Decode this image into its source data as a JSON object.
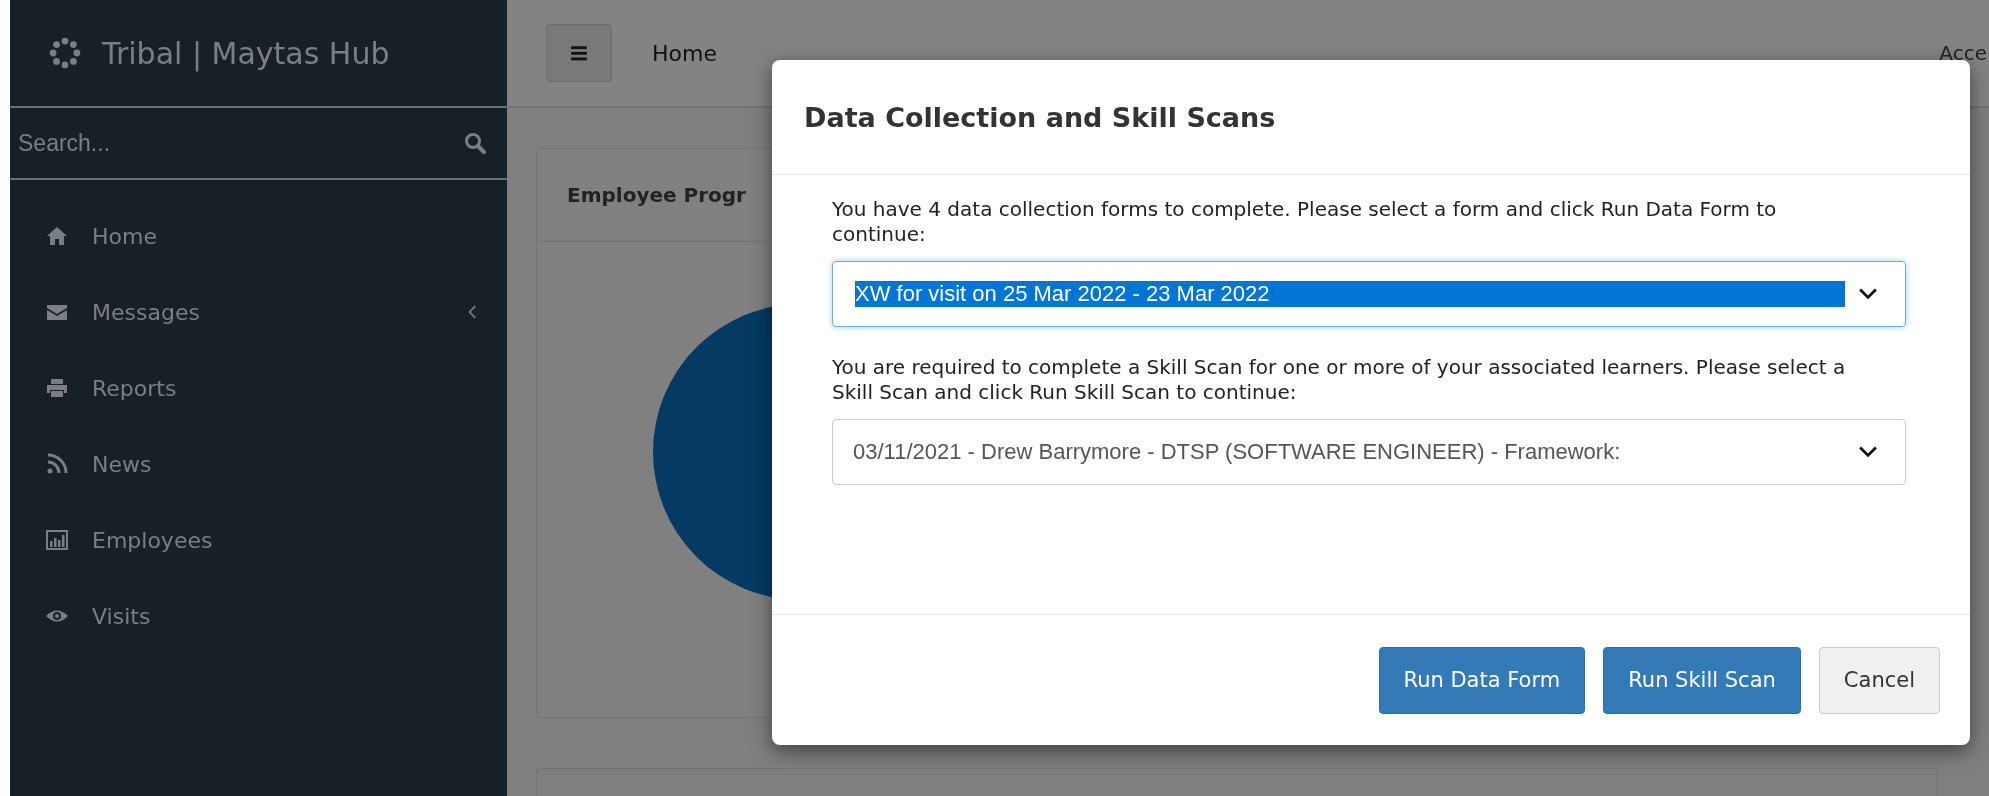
{
  "sidebar": {
    "brand": "Tribal | Maytas Hub",
    "search": {
      "placeholder": "Search..."
    },
    "items": [
      {
        "label": "Home",
        "has_submenu": false
      },
      {
        "label": "Messages",
        "has_submenu": true
      },
      {
        "label": "Reports",
        "has_submenu": false
      },
      {
        "label": "News",
        "has_submenu": false
      },
      {
        "label": "Employees",
        "has_submenu": false
      },
      {
        "label": "Visits",
        "has_submenu": false
      }
    ]
  },
  "header": {
    "breadcrumb": "Home",
    "right_text": "Acce"
  },
  "card": {
    "title": "Employee Progr"
  },
  "dialog": {
    "title": "Data Collection and Skill Scans",
    "sections": [
      {
        "text": "You have 4 data collection forms to complete. Please select a form and click Run Data Form to continue:",
        "value": "XW for visit on 25 Mar 2022 - 23 Mar 2022",
        "focused": true
      },
      {
        "text": "You are required to complete a Skill Scan for one or more of your associated learners. Please select a Skill Scan and click Run Skill Scan to continue:",
        "value": "03/11/2021 - Drew Barrymore - DTSP (SOFTWARE ENGINEER) - Framework:",
        "focused": false
      }
    ],
    "buttons": [
      {
        "label": "Run Data Form",
        "kind": "primary"
      },
      {
        "label": "Run Skill Scan",
        "kind": "primary"
      },
      {
        "label": "Cancel",
        "kind": "default"
      }
    ]
  }
}
